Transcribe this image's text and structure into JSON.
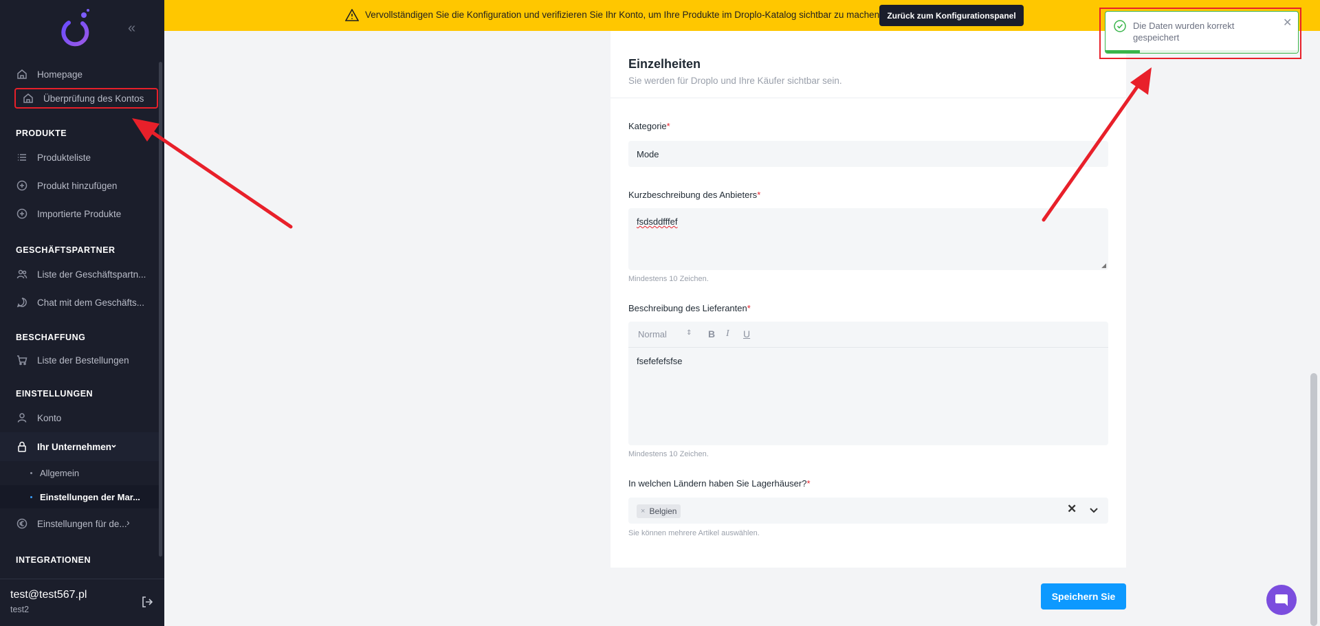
{
  "banner": {
    "text": "Vervollständigen Sie die Konfiguration und verifizieren Sie Ihr Konto, um Ihre Produkte im Droplo-Katalog sichtbar zu machen.",
    "button": "Zurück zum Konfigurationspanel"
  },
  "sidebar": {
    "items": {
      "homepage": "Homepage",
      "account_review": "Überprüfung des Kontos",
      "product_list": "Produkteliste",
      "add_product": "Produkt hinzufügen",
      "imported_products": "Importierte Produkte",
      "partner_list": "Liste der Geschäftspartn...",
      "partner_chat": "Chat mit dem Geschäfts...",
      "order_list": "Liste der Bestellungen",
      "account": "Konto",
      "your_company": "Ihr Unternehmen",
      "general": "Allgemein",
      "market_settings": "Einstellungen der Mar...",
      "settings_for": "Einstellungen für de..."
    },
    "sections": {
      "products": "PRODUKTE",
      "partners": "GESCHÄFTSPARTNER",
      "procurement": "BESCHAFFUNG",
      "settings": "EINSTELLUNGEN",
      "integrations": "INTEGRATIONEN"
    },
    "user": {
      "email": "test@test567.pl",
      "name": "test2"
    }
  },
  "card": {
    "title": "Einzelheiten",
    "subtitle": "Sie werden für Droplo und Ihre Käufer sichtbar sein.",
    "category": {
      "label": "Kategorie",
      "value": "Mode"
    },
    "short_description": {
      "label": "Kurzbeschreibung des Anbieters",
      "value": "fsdsddfffef",
      "hint": "Mindestens 10 Zeichen."
    },
    "supplier_description": {
      "label": "Beschreibung des Lieferanten",
      "format": "Normal",
      "bold": "B",
      "italic": "I",
      "underline": "U",
      "value": "fsefefefsfse",
      "hint": "Mindestens 10 Zeichen."
    },
    "warehouses": {
      "label": "In welchen Ländern haben Sie Lagerhäuser?",
      "chips": [
        "Belgien"
      ],
      "hint": "Sie können mehrere Artikel auswählen."
    },
    "required_mark": "*"
  },
  "save_button": "Speichern Sie",
  "toast": {
    "message": "Die Daten wurden korrekt gespeichert",
    "progress": 0.18,
    "color": "#39b54a"
  },
  "colors": {
    "accent": "#0d99ff",
    "banner": "#ffc700",
    "sidebar": "#1b1e2b",
    "annotation": "#e8202a"
  }
}
